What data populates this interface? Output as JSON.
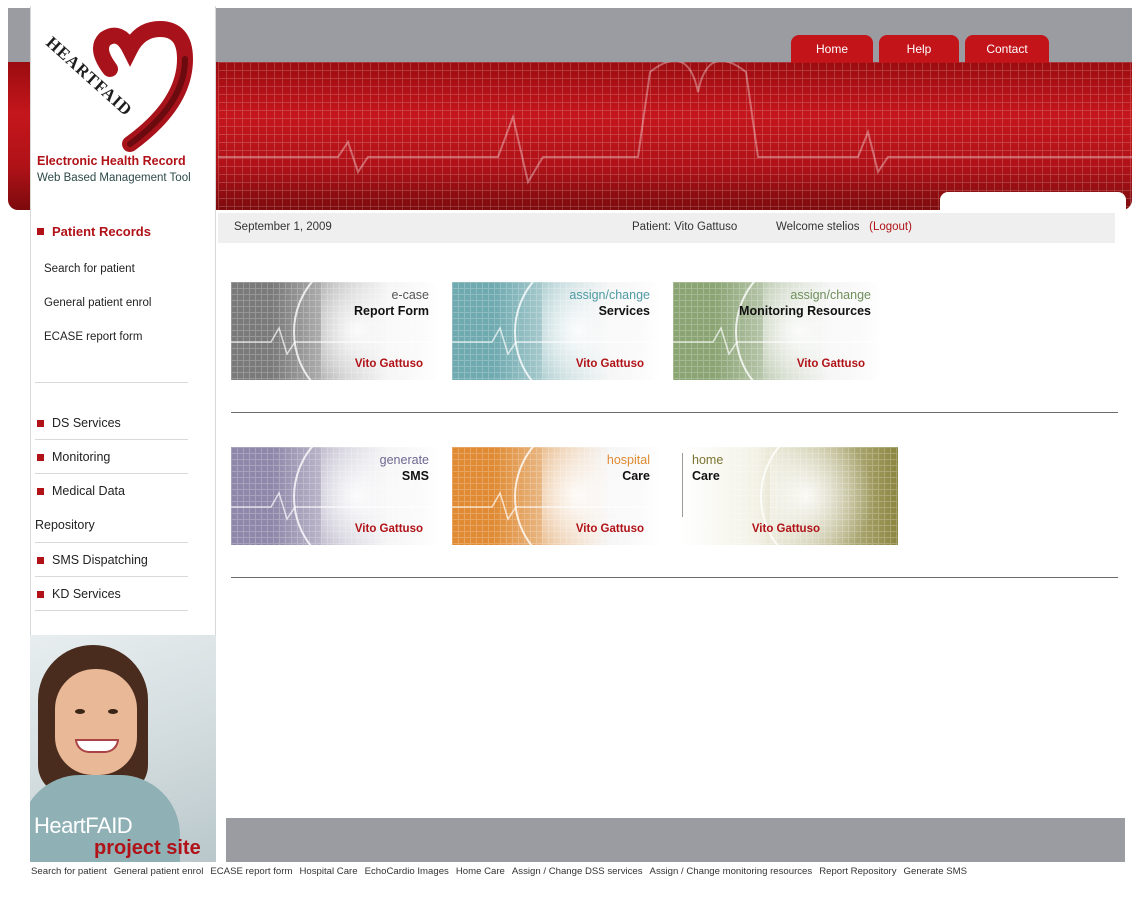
{
  "brand": {
    "logo_text": "HEARTFAID",
    "line1": "Electronic Health Record",
    "line2": "Web Based Management Tool"
  },
  "topnav": {
    "home": "Home",
    "help": "Help",
    "contact": "Contact"
  },
  "sidebar": {
    "heading": "Patient Records",
    "sub_links": [
      "Search for patient",
      "General patient enrol",
      "ECASE report form"
    ],
    "menu": [
      "DS Services",
      "Monitoring",
      "Medical Data",
      "SMS Dispatching",
      "KD Services"
    ],
    "menu_continuation": "Repository"
  },
  "promo": {
    "line1": "HeartFAID",
    "line2": "project site"
  },
  "infobar": {
    "date": "September 1, 2009",
    "patient": "Patient: Vito Gattuso",
    "welcome": "Welcome stelios",
    "logout": "(Logout)"
  },
  "tiles": [
    {
      "top": "e-case",
      "main": "Report Form",
      "name": "Vito Gattuso",
      "color": "#7a7a7a",
      "accent": "#555555"
    },
    {
      "top": "assign/change",
      "main": "Services",
      "name": "Vito Gattuso",
      "color": "#6eaab0",
      "accent": "#4f9aa3"
    },
    {
      "top": "assign/change",
      "main": "Monitoring Resources",
      "name": "Vito Gattuso",
      "color": "#8aa474",
      "accent": "#6e8f5a"
    },
    {
      "top": "generate",
      "main": "SMS",
      "name": "Vito Gattuso",
      "color": "#9088aa",
      "accent": "#6f6790"
    },
    {
      "top": "hospital",
      "main": "Care",
      "name": "Vito Gattuso",
      "color": "#e08b33",
      "accent": "#e08b33"
    },
    {
      "top": "home",
      "main": "Care",
      "name": "Vito Gattuso",
      "color": "#8c8640",
      "accent": "#7a7331"
    }
  ],
  "footer": [
    "Search for patient",
    "General patient enrol",
    "ECASE report form",
    "Hospital Care",
    "EchoCardio Images",
    "Home Care",
    "Assign / Change DSS services",
    "Assign / Change monitoring resources",
    "Report Repository",
    "Generate SMS"
  ]
}
